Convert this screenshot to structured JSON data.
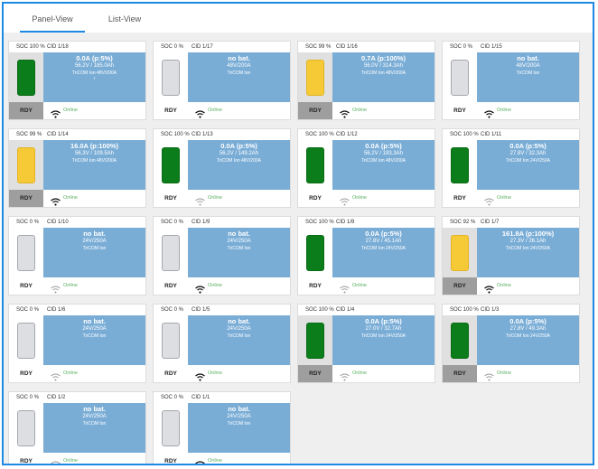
{
  "tabs": [
    {
      "label": "Panel-View",
      "active": true
    },
    {
      "label": "List-View",
      "active": false
    }
  ],
  "colors": {
    "accent": "#1e88e5",
    "info_panel": "#7aadd6",
    "battery_green": "#0b7d1a",
    "battery_yellow": "#f6c936",
    "battery_empty": "#dcdee2",
    "online": "#58b060"
  },
  "cards": [
    {
      "soc": "SOC 100 %",
      "cid": "CID 1/18",
      "line1": "0.0A (p:5%)",
      "line2": "56.2V / 185.0Ah",
      "line3": "TriCOM Ion 48V/200A",
      "line4": "!",
      "status": "RDY",
      "online": "Online",
      "battery": "green",
      "highlight": true,
      "wifi_strong": true
    },
    {
      "soc": "SOC 0 %",
      "cid": "CID 1/17",
      "line1": "no bat.",
      "line2": "48V/200A",
      "line3": "TriCOM Ion",
      "line4": "",
      "status": "RDY",
      "online": "Online",
      "battery": "empty",
      "highlight": false,
      "wifi_strong": true
    },
    {
      "soc": "SOC 99 %",
      "cid": "CID 1/16",
      "line1": "0.7A (p:100%)",
      "line2": "56.0V / 314.3Ah",
      "line3": "TriCOM Ion 48V/200A",
      "line4": "",
      "status": "RDY",
      "online": "Online",
      "battery": "yellow",
      "highlight": true,
      "wifi_strong": true
    },
    {
      "soc": "SOC 0 %",
      "cid": "CID 1/15",
      "line1": "no bat.",
      "line2": "48V/200A",
      "line3": "TriCOM Ion",
      "line4": "",
      "status": "RDY",
      "online": "Online",
      "battery": "empty",
      "highlight": false,
      "wifi_strong": true
    },
    {
      "soc": "SOC 99 %",
      "cid": "CID 1/14",
      "line1": "16.0A (p:100%)",
      "line2": "56.3V / 109.5Ah",
      "line3": "TriCOM Ion 48V/200A",
      "line4": "",
      "status": "RDY",
      "online": "Online",
      "battery": "yellow",
      "highlight": true,
      "wifi_strong": true
    },
    {
      "soc": "SOC 100 %",
      "cid": "CID 1/13",
      "line1": "0.0A (p:5%)",
      "line2": "56.2V / 149.2Ah",
      "line3": "TriCOM Ion 48V/200A",
      "line4": "",
      "status": "RDY",
      "online": "Online",
      "battery": "green",
      "highlight": false,
      "wifi_strong": false
    },
    {
      "soc": "SOC 100 %",
      "cid": "CID 1/12",
      "line1": "0.0A (p:5%)",
      "line2": "56.2V / 193.3Ah",
      "line3": "TriCOM Ion 48V/200A",
      "line4": "",
      "status": "RDY",
      "online": "Online",
      "battery": "green",
      "highlight": false,
      "wifi_strong": false
    },
    {
      "soc": "SOC 100 %",
      "cid": "CID 1/11",
      "line1": "0.0A (p:5%)",
      "line2": "27.8V / 32.3Ah",
      "line3": "TriCOM Ion 24V/250A",
      "line4": "",
      "status": "RDY",
      "online": "Online",
      "battery": "green",
      "highlight": false,
      "wifi_strong": false
    },
    {
      "soc": "SOC 0 %",
      "cid": "CID 1/10",
      "line1": "no bat.",
      "line2": "24V/250A",
      "line3": "TriCOM Ion",
      "line4": "",
      "status": "RDY",
      "online": "Online",
      "battery": "empty",
      "highlight": false,
      "wifi_strong": false
    },
    {
      "soc": "SOC 0 %",
      "cid": "CID 1/9",
      "line1": "no bat.",
      "line2": "24V/250A",
      "line3": "TriCOM Ion",
      "line4": "",
      "status": "RDY",
      "online": "Online",
      "battery": "empty",
      "highlight": false,
      "wifi_strong": true
    },
    {
      "soc": "SOC 100 %",
      "cid": "CID 1/8",
      "line1": "0.0A (p:5%)",
      "line2": "27.8V / 45.1Ah",
      "line3": "TriCOM Ion 24V/250A",
      "line4": "",
      "status": "RDY",
      "online": "Online",
      "battery": "green",
      "highlight": false,
      "wifi_strong": false
    },
    {
      "soc": "SOC 92 %",
      "cid": "CID 1/7",
      "line1": "161.8A (p:100%)",
      "line2": "27.3V / 26.1Ah",
      "line3": "TriCOM Ion 24V/250A",
      "line4": "",
      "status": "RDY",
      "online": "Online",
      "battery": "yellow",
      "highlight": true,
      "wifi_strong": true
    },
    {
      "soc": "SOC 0 %",
      "cid": "CID 1/6",
      "line1": "no bat.",
      "line2": "24V/250A",
      "line3": "TriCOM Ion",
      "line4": "",
      "status": "RDY",
      "online": "Online",
      "battery": "empty",
      "highlight": false,
      "wifi_strong": false
    },
    {
      "soc": "SOC 0 %",
      "cid": "CID 1/5",
      "line1": "no bat.",
      "line2": "24V/250A",
      "line3": "TriCOM Ion",
      "line4": "",
      "status": "RDY",
      "online": "Online",
      "battery": "empty",
      "highlight": false,
      "wifi_strong": true
    },
    {
      "soc": "SOC 100 %",
      "cid": "CID 1/4",
      "line1": "0.0A (p:5%)",
      "line2": "27.0V / 32.7Ah",
      "line3": "TriCOM Ion 24V/250A",
      "line4": "",
      "status": "RDY",
      "online": "Online",
      "battery": "green",
      "highlight": true,
      "wifi_strong": false
    },
    {
      "soc": "SOC 100 %",
      "cid": "CID 1/3",
      "line1": "0.0A (p:5%)",
      "line2": "27.8V / 49.3Ah",
      "line3": "TriCOM Ion 24V/250A",
      "line4": "",
      "status": "RDY",
      "online": "Online",
      "battery": "green",
      "highlight": true,
      "wifi_strong": false
    },
    {
      "soc": "SOC 0 %",
      "cid": "CID 1/2",
      "line1": "no bat.",
      "line2": "24V/250A",
      "line3": "TriCOM Ion",
      "line4": "",
      "status": "RDY",
      "online": "Online",
      "battery": "empty",
      "highlight": false,
      "wifi_strong": false
    },
    {
      "soc": "SOC 0 %",
      "cid": "CID 1/1",
      "line1": "no bat.",
      "line2": "24V/250A",
      "line3": "TriCOM Ion",
      "line4": "",
      "status": "RDY",
      "online": "Online",
      "battery": "empty",
      "highlight": false,
      "wifi_strong": true
    }
  ]
}
